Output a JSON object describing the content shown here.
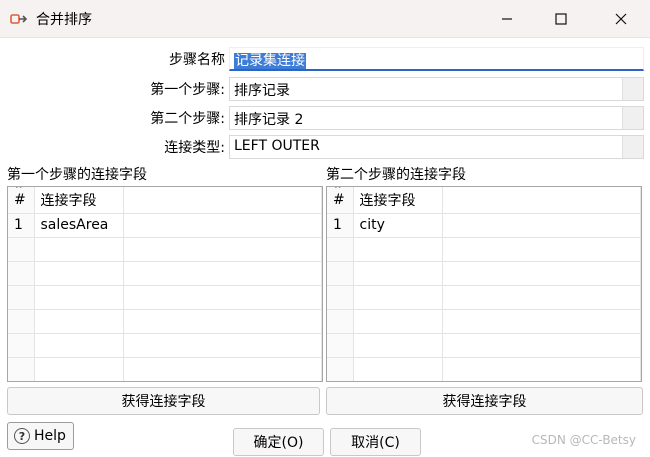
{
  "window": {
    "title": "合并排序",
    "minimize_icon": "minimize-icon",
    "maximize_icon": "maximize-icon",
    "close_icon": "close-icon"
  },
  "form": {
    "step_name_label": "步骤名称",
    "step_name_value": "记录集连接",
    "first_step_label": "第一个步骤:",
    "first_step_value": "排序记录",
    "second_step_label": "第二个步骤:",
    "second_step_value": "排序记录 2",
    "join_type_label": "连接类型:",
    "join_type_value": "LEFT OUTER"
  },
  "left_panel": {
    "title": "第一个步骤的连接字段",
    "headers": [
      "#",
      "连接字段"
    ],
    "rows": [
      [
        "1",
        "salesArea"
      ]
    ],
    "button_label": "获得连接字段"
  },
  "right_panel": {
    "title": "第二个步骤的连接字段",
    "headers": [
      "#",
      "连接字段"
    ],
    "rows": [
      [
        "1",
        "city"
      ]
    ],
    "button_label": "获得连接字段"
  },
  "footer": {
    "help_label": "Help",
    "ok_label": "确定(O)",
    "cancel_label": "取消(C)",
    "watermark": "CSDN @CC-Betsy"
  }
}
